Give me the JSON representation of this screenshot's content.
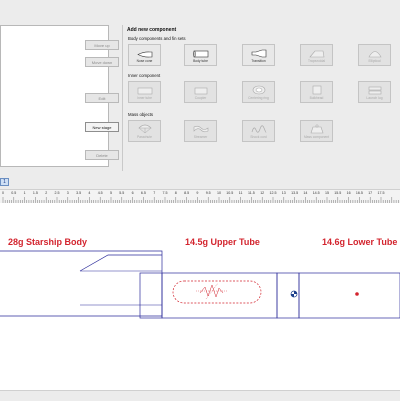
{
  "side_buttons": {
    "move_up": "Move up",
    "move_down": "Move down",
    "edit": "Edit",
    "new_stage": "New stage",
    "delete": "Delete"
  },
  "add_panel": {
    "title": "Add new component",
    "body_section": "Body components and fin sets",
    "inner_section": "Inner component",
    "mass_section": "Mass objects"
  },
  "body_components": [
    {
      "label": "Nose cone",
      "icon": "nose-cone-icon",
      "enabled": true
    },
    {
      "label": "Body tube",
      "icon": "body-tube-icon",
      "enabled": true
    },
    {
      "label": "Transition",
      "icon": "transition-icon",
      "enabled": true
    },
    {
      "label": "Trapezoidal",
      "icon": "trapezoidal-fin-icon",
      "enabled": false
    },
    {
      "label": "Elliptical",
      "icon": "elliptical-fin-icon",
      "enabled": false
    }
  ],
  "inner_components": [
    {
      "label": "Inner tube",
      "icon": "inner-tube-icon",
      "enabled": false
    },
    {
      "label": "Coupler",
      "icon": "coupler-icon",
      "enabled": false
    },
    {
      "label": "Centering ring",
      "icon": "centering-ring-icon",
      "enabled": false
    },
    {
      "label": "Bulkhead",
      "icon": "bulkhead-icon",
      "enabled": false
    },
    {
      "label": "Launch lug",
      "icon": "launch-lug-icon",
      "enabled": false
    }
  ],
  "mass_components": [
    {
      "label": "Parachute",
      "icon": "parachute-icon",
      "enabled": false
    },
    {
      "label": "Streamer",
      "icon": "streamer-icon",
      "enabled": false
    },
    {
      "label": "Shock cord",
      "icon": "shock-cord-icon",
      "enabled": false
    },
    {
      "label": "Mass component",
      "icon": "mass-component-icon",
      "enabled": false
    }
  ],
  "tabs": {
    "active": "1"
  },
  "ruler": {
    "labels": [
      "0",
      "0.5",
      "1",
      "1.5",
      "2",
      "2.5",
      "3",
      "3.5",
      "4",
      "4.5",
      "5",
      "5.5",
      "6",
      "6.5",
      "7",
      "7.5",
      "8",
      "8.5",
      "9",
      "9.5",
      "10",
      "10.5",
      "11",
      "11.5",
      "12",
      "12.5",
      "13",
      "13.5",
      "14",
      "14.5",
      "15",
      "15.5",
      "16",
      "16.5",
      "17",
      "17.5"
    ]
  },
  "mass_labels": {
    "starship_body": "28g Starship Body",
    "upper_tube": "14.5g Upper Tube",
    "lower_tube": "14.6g Lower Tube"
  },
  "colors": {
    "outline": "#2b2b9a",
    "mass_text": "#d3242e",
    "cg_marker": "#1a3d8a"
  }
}
